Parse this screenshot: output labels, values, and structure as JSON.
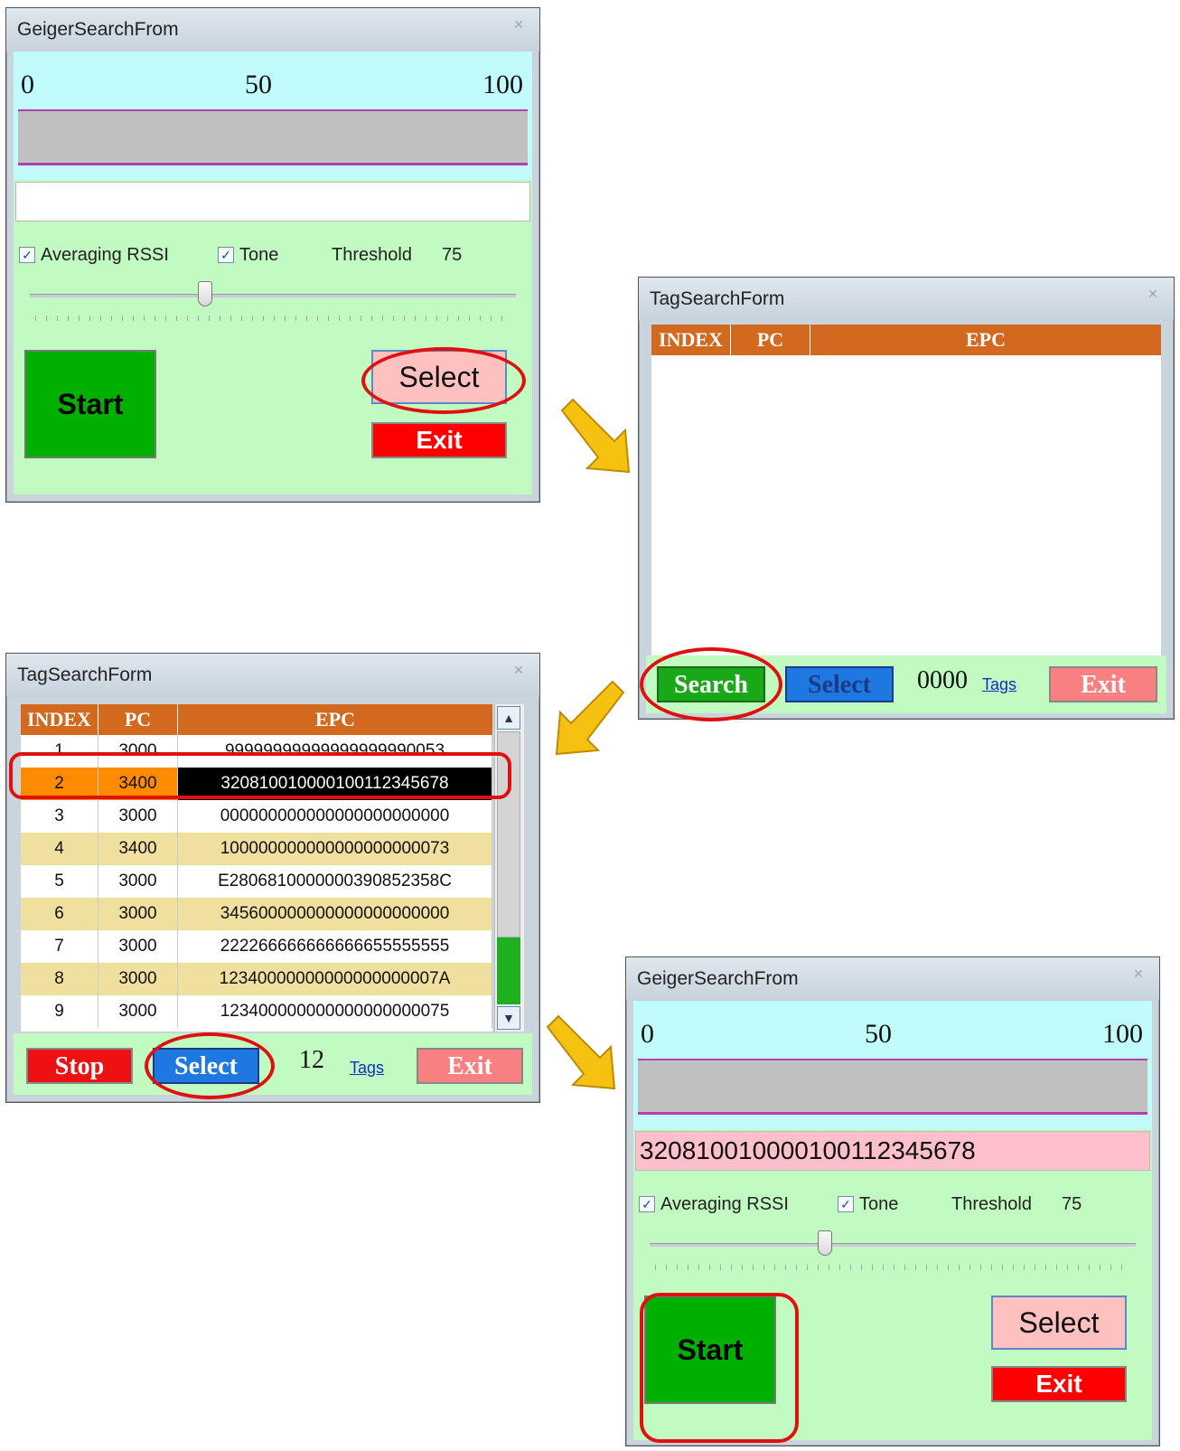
{
  "geiger_form_1": {
    "title": "GeigerSearchFrom",
    "scale": {
      "min": "0",
      "mid": "50",
      "max": "100"
    },
    "meter_level": 0,
    "epc_value": "",
    "averaging_label": "Averaging RSSI",
    "averaging_checked": true,
    "tone_label": "Tone",
    "tone_checked": true,
    "threshold_label": "Threshold",
    "threshold_value": "75",
    "start_label": "Start",
    "select_label": "Select",
    "exit_label": "Exit"
  },
  "tag_form_empty": {
    "title": "TagSearchForm",
    "columns": [
      "INDEX",
      "PC",
      "EPC"
    ],
    "search_label": "Search",
    "select_label": "Select",
    "count": "0000",
    "tags_label": "Tags",
    "exit_label": "Exit"
  },
  "tag_form_results": {
    "title": "TagSearchForm",
    "columns": [
      "INDEX",
      "PC",
      "EPC"
    ],
    "rows": [
      {
        "index": "1",
        "pc": "3000",
        "epc": "99999999999999999990053"
      },
      {
        "index": "2",
        "pc": "3400",
        "epc": "320810010000100112345678",
        "selected": true
      },
      {
        "index": "3",
        "pc": "3000",
        "epc": "000000000000000000000000"
      },
      {
        "index": "4",
        "pc": "3400",
        "epc": "100000000000000000000073"
      },
      {
        "index": "5",
        "pc": "3000",
        "epc": "E2806810000000390852358C"
      },
      {
        "index": "6",
        "pc": "3000",
        "epc": "345600000000000000000000"
      },
      {
        "index": "7",
        "pc": "3000",
        "epc": "222266666666666655555555"
      },
      {
        "index": "8",
        "pc": "3000",
        "epc": "12340000000000000000007A"
      },
      {
        "index": "9",
        "pc": "3000",
        "epc": "123400000000000000000075"
      }
    ],
    "stop_label": "Stop",
    "select_label": "Select",
    "count": "12",
    "tags_label": "Tags",
    "exit_label": "Exit"
  },
  "geiger_form_2": {
    "title": "GeigerSearchFrom",
    "scale": {
      "min": "0",
      "mid": "50",
      "max": "100"
    },
    "meter_level": 0,
    "epc_value": "320810010000100112345678",
    "averaging_label": "Averaging RSSI",
    "averaging_checked": true,
    "tone_label": "Tone",
    "tone_checked": true,
    "threshold_label": "Threshold",
    "threshold_value": "75",
    "start_label": "Start",
    "select_label": "Select",
    "exit_label": "Exit"
  },
  "colors": {
    "client_green": "#c1fbc1",
    "scale_cyan": "#c1fbfb",
    "grid_header": "#d2691e",
    "row_alt": "#f0e0a0",
    "selected_row": "#ff8c00",
    "annotation_red": "#e01010",
    "arrow_yellow": "#f5c211"
  }
}
